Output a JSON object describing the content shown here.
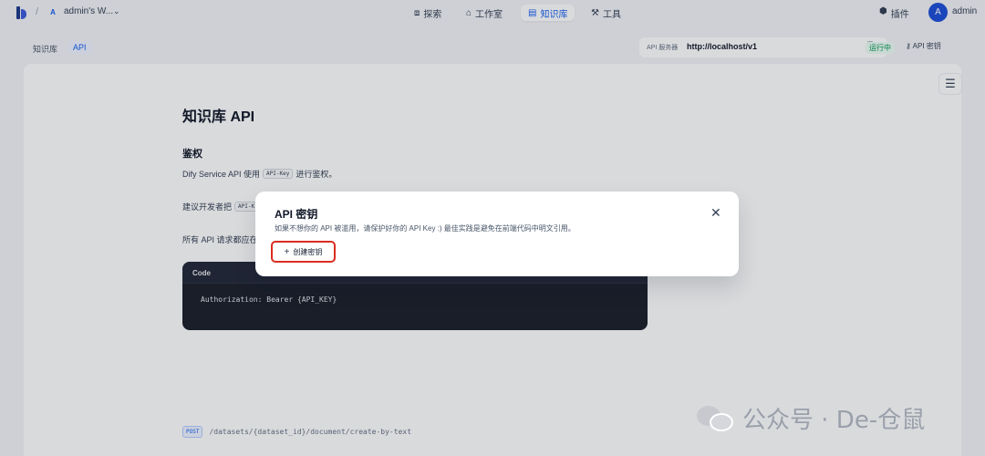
{
  "topbar": {
    "workspace_avatar": "A",
    "workspace_name": "admin's W...",
    "workspace_chevron": "⌄",
    "nav": [
      {
        "label": "探索",
        "icon": "compass-icon"
      },
      {
        "label": "工作室",
        "icon": "studio-icon"
      },
      {
        "label": "知识库",
        "icon": "book-icon",
        "active": true
      },
      {
        "label": "工具",
        "icon": "tools-icon"
      }
    ],
    "plugins_label": "插件",
    "user_avatar": "A",
    "user_name": "admin"
  },
  "subbar": {
    "crumb_kb": "知识库",
    "crumb_api": "API",
    "api_server_label": "API 服务器",
    "api_server_value": "http://localhost/v1",
    "status": "运行中",
    "api_key_button": "API 密钥"
  },
  "doc": {
    "title": "知识库 API",
    "auth_heading": "鉴权",
    "p1_before": "Dify Service API 使用",
    "p1_code": "API-Key",
    "p1_after": "进行鉴权。",
    "p2_before": "建议开发者把",
    "p2_code": "API-K",
    "p3": "所有 API 请求都应在",
    "code_header": "Code",
    "code_body": "Authorization: Bearer {API_KEY}",
    "endpoint_method": "POST",
    "endpoint_path": "/datasets/{dataset_id}/document/create-by-text"
  },
  "modal": {
    "title": "API 密钥",
    "description": "如果不想你的 API 被滥用，请保护好你的 API Key :) 最佳实践是避免在前端代码中明文引用。",
    "close": "✕",
    "create_label": "创建密钥",
    "create_plus": "+"
  },
  "watermark": {
    "text": "公众号 · De-仓鼠"
  },
  "colors": {
    "accent": "#155eef",
    "highlight_border": "#d92d20",
    "status_green": "#039855"
  }
}
